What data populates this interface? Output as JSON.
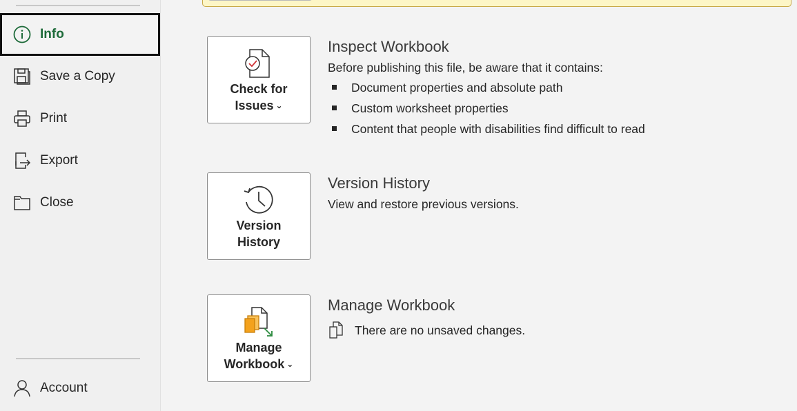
{
  "sidebar": {
    "items": [
      {
        "label": "Info",
        "icon": "info-icon"
      },
      {
        "label": "Save a Copy",
        "icon": "save-copy-icon"
      },
      {
        "label": "Print",
        "icon": "printer-icon"
      },
      {
        "label": "Export",
        "icon": "export-icon"
      },
      {
        "label": "Close",
        "icon": "folder-close-icon"
      }
    ],
    "account": {
      "label": "Account",
      "icon": "person-icon"
    }
  },
  "inspect": {
    "button_line1": "Check for",
    "button_line2": "Issues",
    "title": "Inspect Workbook",
    "description": "Before publishing this file, be aware that it contains:",
    "bullets": [
      "Document properties and absolute path",
      "Custom worksheet properties",
      "Content that people with disabilities find difficult to read"
    ]
  },
  "version": {
    "button_line1": "Version",
    "button_line2": "History",
    "title": "Version History",
    "description": "View and restore previous versions."
  },
  "manage": {
    "button_line1": "Manage",
    "button_line2": "Workbook",
    "title": "Manage Workbook",
    "status": "There are no unsaved changes."
  },
  "colors": {
    "accent": "#1e6b3a",
    "warning_bg": "#fdf6c6",
    "check_red": "#d13438",
    "manage_orange": "#f4a21d",
    "manage_green": "#2b8a3e"
  }
}
